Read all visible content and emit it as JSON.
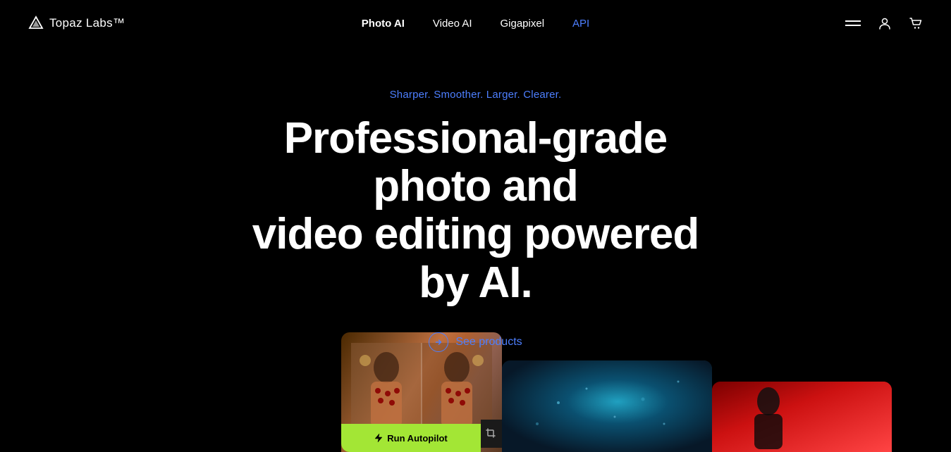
{
  "nav": {
    "logo_text": "Topaz Labs™",
    "links": [
      {
        "id": "photo-ai",
        "label": "Photo AI",
        "active": true,
        "accent": false
      },
      {
        "id": "video-ai",
        "label": "Video AI",
        "active": false,
        "accent": false
      },
      {
        "id": "gigapixel",
        "label": "Gigapixel",
        "active": false,
        "accent": false
      },
      {
        "id": "api",
        "label": "API",
        "active": false,
        "accent": true
      }
    ]
  },
  "hero": {
    "tagline": "Sharper. Smoother. Larger. Clearer.",
    "title_line1": "Professional-grade photo and",
    "title_line2": "video editing powered by AI.",
    "cta_label": "See products"
  },
  "demo": {
    "autopilot_label": "Run Autopilot",
    "colors": {
      "accent_blue": "#4d7fff",
      "accent_green": "#a3e635",
      "bg_dark": "#000000"
    }
  }
}
